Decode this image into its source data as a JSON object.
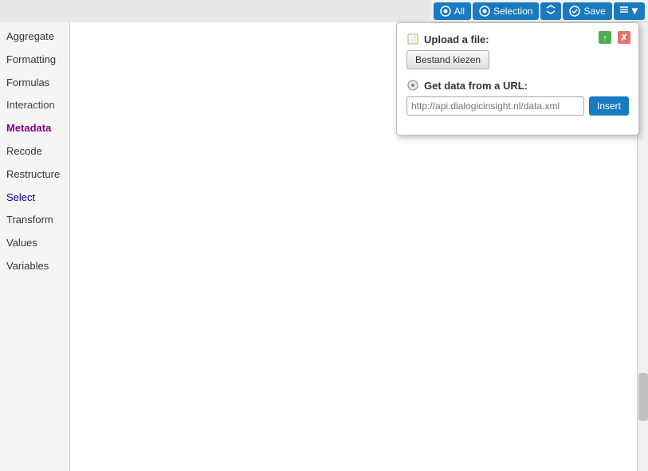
{
  "toolbar": {
    "all_label": "All",
    "selection_label": "Selection",
    "save_label": "Save",
    "expand_tooltip": "Expand",
    "check_tooltip": "Check",
    "more_tooltip": "More"
  },
  "sidebar": {
    "items": [
      {
        "id": "aggregate",
        "label": "Aggregate",
        "style": "normal"
      },
      {
        "id": "formatting",
        "label": "Formatting",
        "style": "normal"
      },
      {
        "id": "formulas",
        "label": "Formulas",
        "style": "normal"
      },
      {
        "id": "interaction",
        "label": "Interaction",
        "style": "normal"
      },
      {
        "id": "metadata",
        "label": "Metadata",
        "style": "metadata"
      },
      {
        "id": "recode",
        "label": "Recode",
        "style": "normal"
      },
      {
        "id": "restructure",
        "label": "Restructure",
        "style": "normal"
      },
      {
        "id": "select",
        "label": "Select",
        "style": "select"
      },
      {
        "id": "transform",
        "label": "Transform",
        "style": "normal"
      },
      {
        "id": "values",
        "label": "Values",
        "style": "normal"
      },
      {
        "id": "variables",
        "label": "Variables",
        "style": "normal"
      }
    ]
  },
  "popup": {
    "upload_section_title": "Upload a file:",
    "file_btn_label": "Bestand kiezen",
    "url_section_title": "Get data from a URL:",
    "url_placeholder": "http://api.dialogicinsight.nl/data.xml",
    "insert_btn_label": "Insert"
  }
}
